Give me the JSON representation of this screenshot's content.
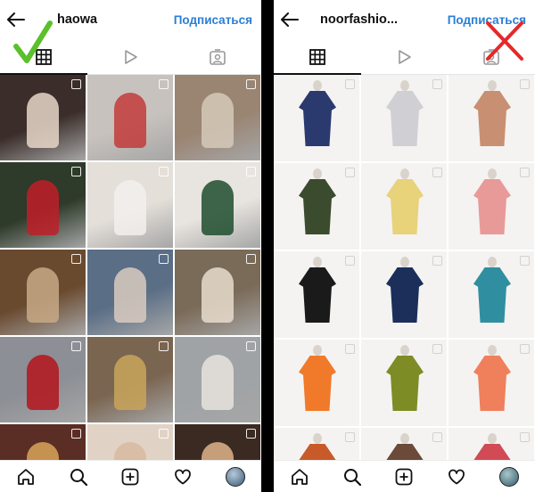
{
  "left": {
    "username": "haowa",
    "subscribe_label": "Подписаться",
    "verdict_icon": "green-checkmark",
    "tiles": [
      {
        "bg": "#3a2d2a",
        "accent": "#e8d7c8"
      },
      {
        "bg": "#c7c2bd",
        "accent": "#c23b3b"
      },
      {
        "bg": "#9a8472",
        "accent": "#d5c9b8"
      },
      {
        "bg": "#2e3a2a",
        "accent": "#c01f28"
      },
      {
        "bg": "#e4dfd9",
        "accent": "#f2f0ed"
      },
      {
        "bg": "#e8e4df",
        "accent": "#1f4d2e"
      },
      {
        "bg": "#6a4a2f",
        "accent": "#c8a986"
      },
      {
        "bg": "#5a6e86",
        "accent": "#d9cbbf"
      },
      {
        "bg": "#7a6a58",
        "accent": "#e8dccd"
      },
      {
        "bg": "#8c8f95",
        "accent": "#b4141c"
      },
      {
        "bg": "#7a6550",
        "accent": "#c9a45a"
      },
      {
        "bg": "#9fa3a6",
        "accent": "#e8e4de"
      },
      {
        "bg": "#5a2e25",
        "accent": "#d8a35a"
      },
      {
        "bg": "#e0d3c6",
        "accent": "#d7b89d"
      },
      {
        "bg": "#3a2a22",
        "accent": "#e1b38a"
      }
    ]
  },
  "right": {
    "username": "noorfashio...",
    "subscribe_label": "Подписаться",
    "verdict_icon": "red-cross",
    "tiles": [
      {
        "bg": "#f4f3f1",
        "accent": "#2a3a6e"
      },
      {
        "bg": "#f4f3f1",
        "accent": "#cfcfd4"
      },
      {
        "bg": "#f4f3f1",
        "accent": "#c98f72"
      },
      {
        "bg": "#f4f3f1",
        "accent": "#3b4b2e"
      },
      {
        "bg": "#f4f3f1",
        "accent": "#e8d27a"
      },
      {
        "bg": "#f4f3f1",
        "accent": "#e89a98"
      },
      {
        "bg": "#f4f3f1",
        "accent": "#1a1a1a"
      },
      {
        "bg": "#f4f3f1",
        "accent": "#1b2f5a"
      },
      {
        "bg": "#f4f3f1",
        "accent": "#2f8fa0"
      },
      {
        "bg": "#f4f3f1",
        "accent": "#f07a2a"
      },
      {
        "bg": "#f4f3f1",
        "accent": "#7d8c25"
      },
      {
        "bg": "#f4f3f1",
        "accent": "#f07f5c"
      },
      {
        "bg": "#f4f3f1",
        "accent": "#c85a2a"
      },
      {
        "bg": "#f4f3f1",
        "accent": "#6b4a3a"
      },
      {
        "bg": "#f4f3f1",
        "accent": "#d24a55"
      }
    ]
  },
  "nav_icons": [
    "home-icon",
    "search-icon",
    "add-post-icon",
    "heart-icon",
    "profile-avatar"
  ],
  "tab_icons": [
    "grid-icon",
    "reels-icon",
    "tagged-icon"
  ]
}
